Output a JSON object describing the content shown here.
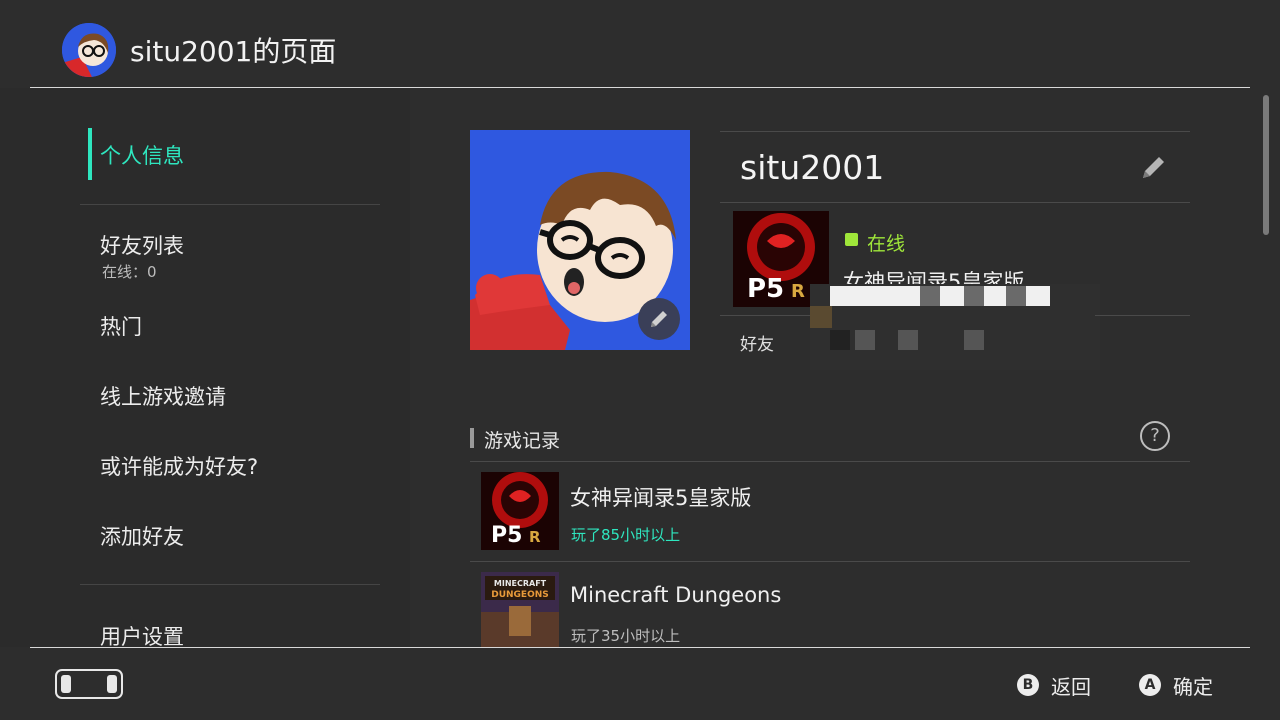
{
  "header": {
    "title": "situ2001的页面",
    "avatar_icon": "mii-avatar-icon"
  },
  "sidebar": {
    "items": [
      {
        "label": "个人信息",
        "active": true
      },
      {
        "label": "好友列表",
        "sub": "在线：0"
      },
      {
        "label": "热门"
      },
      {
        "label": "线上游戏邀请"
      },
      {
        "label": "或许能成为好友?"
      },
      {
        "label": "添加好友"
      },
      {
        "label": "用户设置"
      }
    ],
    "accent": "#2ee6bf"
  },
  "profile": {
    "username": "situ2001",
    "status": "在线",
    "status_color": "#9fe63a",
    "current_game": "女神异闻录5皇家版",
    "friend_code_label": "好友"
  },
  "records": {
    "title": "游戏记录",
    "items": [
      {
        "name": "女神异闻录5皇家版",
        "time": "玩了85小时以上",
        "time_color": "#2ee6bf"
      },
      {
        "name": "Minecraft Dungeons",
        "time": "玩了35小时以上",
        "time_color": "#bdbdbd"
      }
    ]
  },
  "footer": {
    "back_key": "B",
    "back_label": "返回",
    "ok_key": "A",
    "ok_label": "确定"
  }
}
